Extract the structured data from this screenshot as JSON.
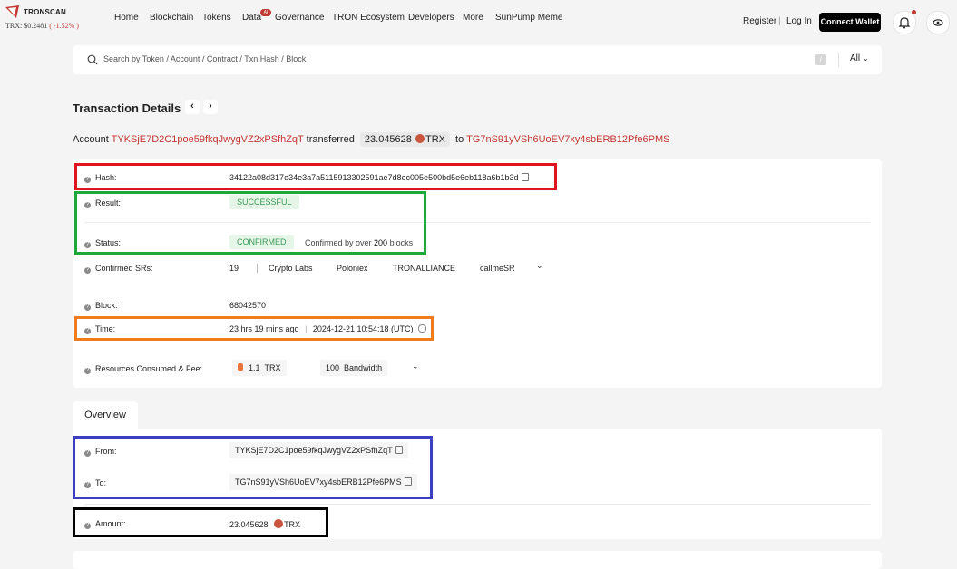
{
  "header": {
    "logo_text": "TRONSCAN",
    "price_label": "TRX: $0.2481",
    "price_change": "( -1.52% )",
    "nav": [
      "Home",
      "Blockchain",
      "Tokens",
      "Data",
      "Governance",
      "TRON Ecosystem",
      "Developers",
      "More",
      "SunPump Meme"
    ],
    "data_badge": "AI",
    "register": "Register",
    "separator": "|",
    "login": "Log In",
    "connect_wallet": "Connect Wallet",
    "icons": [
      "bell-icon",
      "eye-icon"
    ]
  },
  "search": {
    "placeholder": "Search by Token / Account / Contract / Txn Hash / Block",
    "shortcut": "/",
    "filter": "All"
  },
  "page": {
    "title": "Transaction Details",
    "prev": "‹",
    "next": "›"
  },
  "summary": {
    "account_label": "Account",
    "from": "TYKSjE7D2C1poe59fkqJwygVZ2xPSfhZqT",
    "transferred": "transferred",
    "amount": "23.045628",
    "token": "TRX",
    "to_label": "to",
    "to": "TG7nS91yVSh6UoEV7xy4sbERB12Pfe6PMS"
  },
  "details": {
    "hash_label": "Hash:",
    "hash": "34122a08d317e34e3a7a5115913302591ae7d8ec005e500bd5e6eb118a6b1b3d",
    "result_label": "Result:",
    "result": "SUCCESSFUL",
    "status_label": "Status:",
    "status": "CONFIRMED",
    "confirm_text_prefix": "Confirmed by over",
    "confirm_count": "200",
    "confirm_text_suffix": "blocks",
    "srs_label": "Confirmed SRs:",
    "srs_count": "19",
    "srs": [
      "Crypto Labs",
      "Poloniex",
      "TRONALLIANCE",
      "callmeSR"
    ],
    "block_label": "Block:",
    "block": "68042570",
    "time_label": "Time:",
    "time_ago": "23 hrs 19 mins ago",
    "time_sep": "|",
    "time_utc": "2024-12-21 10:54:18 (UTC)",
    "resources_label": "Resources Consumed & Fee:",
    "fee_amount": "1.1",
    "fee_token": "TRX",
    "bandwidth_amount": "100",
    "bandwidth_label": "Bandwidth"
  },
  "overview": {
    "tab": "Overview",
    "from_label": "From:",
    "from": "TYKSjE7D2C1poe59fkqJwygVZ2xPSfhZqT",
    "to_label": "To:",
    "to": "TG7nS91yVSh6UoEV7xy4sbERB12Pfe6PMS",
    "amount_label": "Amount:",
    "amount": "23.045628",
    "token": "TRX"
  },
  "highlight_colors": {
    "hash": "#e0141e",
    "result_status": "#1fa83a",
    "time": "#f07c1e",
    "from_to": "#3a3fc4",
    "amount": "#000000"
  }
}
